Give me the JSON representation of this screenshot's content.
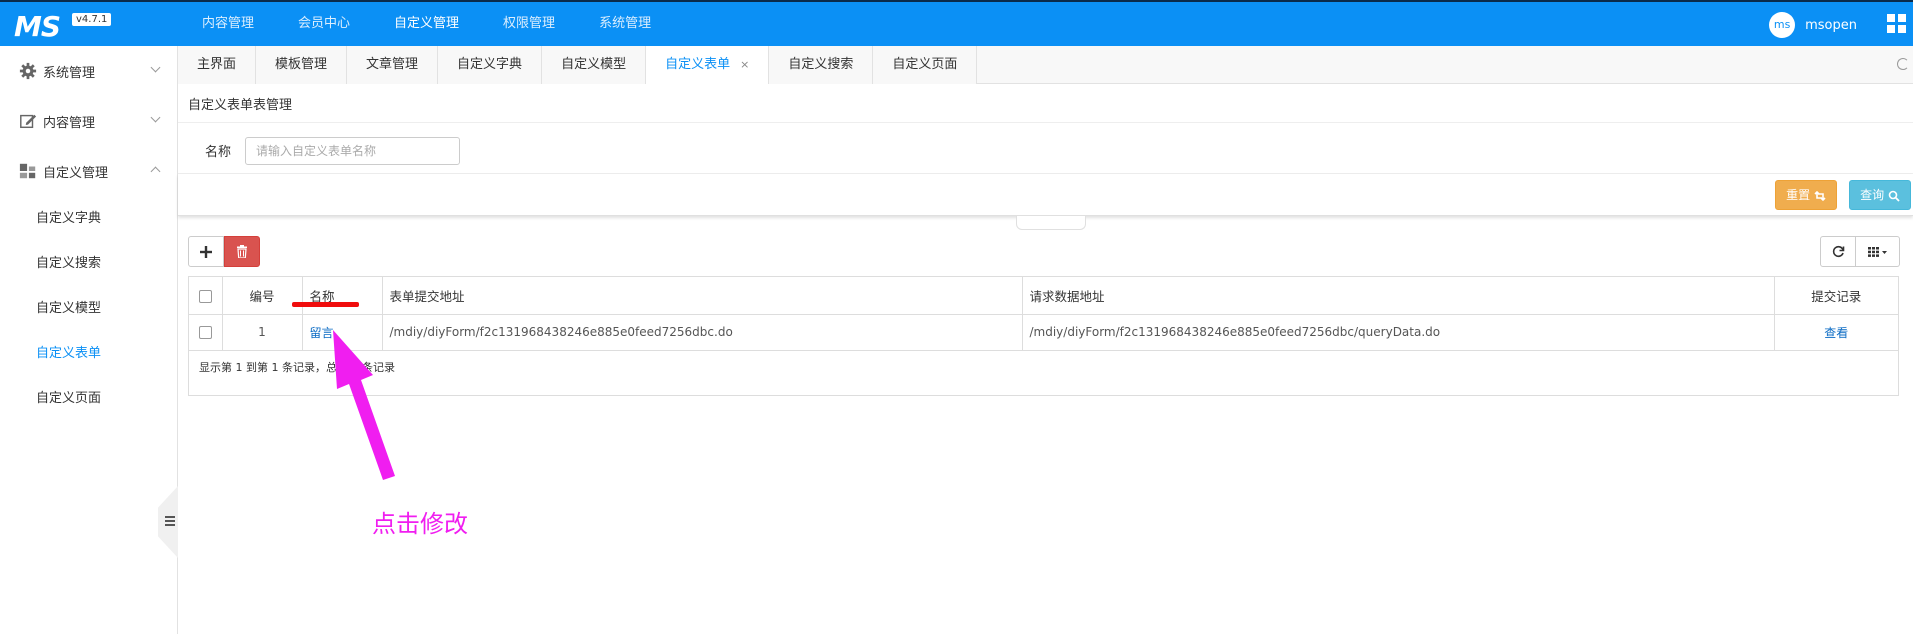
{
  "header": {
    "logo": "MS",
    "version": "v4.7.1",
    "nav": [
      "内容管理",
      "会员中心",
      "自定义管理",
      "权限管理",
      "系统管理"
    ],
    "active_nav": "自定义管理",
    "user": {
      "avatar": "ms",
      "name": "msopen"
    },
    "icons": {
      "menu": "grid-icon"
    }
  },
  "sidebar": {
    "groups": [
      {
        "label": "系统管理",
        "icon": "gear-icon",
        "expanded": false
      },
      {
        "label": "内容管理",
        "icon": "edit-icon",
        "expanded": false
      },
      {
        "label": "自定义管理",
        "icon": "blocks-icon",
        "expanded": true
      }
    ],
    "items": [
      "自定义字典",
      "自定义搜索",
      "自定义模型",
      "自定义表单",
      "自定义页面"
    ],
    "active_item": "自定义表单"
  },
  "tabs": {
    "items": [
      "主界面",
      "模板管理",
      "文章管理",
      "自定义字典",
      "自定义模型",
      "自定义表单",
      "自定义搜索",
      "自定义页面"
    ],
    "active": "自定义表单",
    "close_glyph": "×"
  },
  "page": {
    "title": "自定义表单表管理",
    "search": {
      "label": "名称",
      "placeholder": "请输入自定义表单名称",
      "value": ""
    },
    "buttons": {
      "reset": "重置",
      "query": "查询"
    }
  },
  "table": {
    "columns": [
      "编号",
      "名称",
      "表单提交地址",
      "请求数据地址",
      "提交记录"
    ],
    "rows": [
      {
        "id": "1",
        "name": "留言",
        "submit_url": "/mdiy/diyForm/f2c131968438246e885e0feed7256dbc.do",
        "query_url": "/mdiy/diyForm/f2c131968438246e885e0feed7256dbc/queryData.do",
        "action": "查看"
      }
    ],
    "pager_text": "显示第 1 到第 1 条记录，总共 1 条记录"
  },
  "annotation": {
    "text": "点击修改",
    "arrow_color": "#f01ef0",
    "underline_color": "#f00d0d"
  },
  "colors": {
    "primary": "#0b90f5",
    "reset": "#f0ad4e",
    "query": "#5bc0de",
    "delete": "#d9534f"
  }
}
